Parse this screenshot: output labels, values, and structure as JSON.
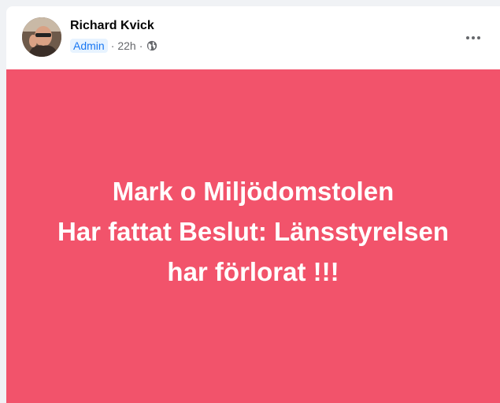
{
  "post": {
    "author": "Richard Kvick",
    "badge": "Admin",
    "separator": "·",
    "time": "22h",
    "visibility_icon": "globe-icon",
    "more_icon": "more-options-icon",
    "message": "Mark o Miljödomstolen\nHar fattat Beslut: Länsstyrelsen\nhar förlorat !!!"
  },
  "colors": {
    "banner_background": "#f2536b",
    "badge_text": "#1877f2",
    "badge_background": "#e7f3ff"
  }
}
